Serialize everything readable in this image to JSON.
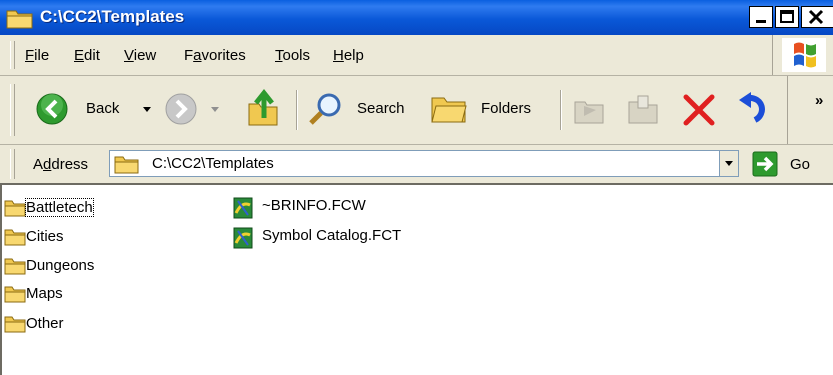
{
  "window": {
    "title": "C:\\CC2\\Templates",
    "minimize_label": "_",
    "maximize_label": "□",
    "close_label": "X"
  },
  "menu": {
    "items": [
      {
        "label": "File",
        "underline": "F"
      },
      {
        "label": "Edit",
        "underline": "E"
      },
      {
        "label": "View",
        "underline": "V"
      },
      {
        "label": "Favorites",
        "underline": "a"
      },
      {
        "label": "Tools",
        "underline": "T"
      },
      {
        "label": "Help",
        "underline": "H"
      }
    ]
  },
  "toolbar": {
    "back_label": "Back",
    "search_label": "Search",
    "folders_label": "Folders",
    "more_label": "»"
  },
  "address": {
    "label": "Address",
    "value": "C:\\CC2\\Templates",
    "go_label": "Go"
  },
  "folders": [
    "Battletech",
    "Cities",
    "Dungeons",
    "Maps",
    "Other"
  ],
  "files": [
    "~BRINFO.FCW",
    "Symbol Catalog.FCT"
  ],
  "colors": {
    "titlebar": "#0a58d8",
    "chrome": "#ece9d8",
    "folder": "#f0c850",
    "back_green": "#2e9a2e",
    "delete_red": "#e02020",
    "undo_blue": "#1c4ed8"
  }
}
